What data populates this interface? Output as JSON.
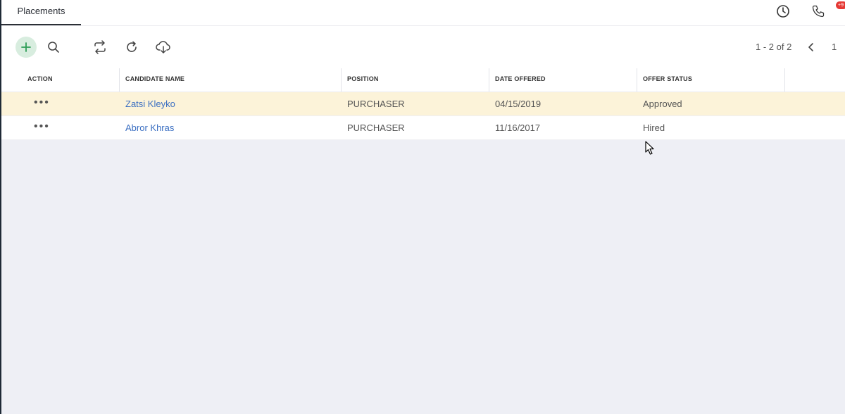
{
  "tab": {
    "label": "Placements"
  },
  "topbar": {
    "badge": "+9"
  },
  "pager": {
    "range": "1 - 2 of 2",
    "page": "1"
  },
  "table": {
    "headers": [
      "ACTION",
      "CANDIDATE NAME",
      "POSITION",
      "DATE OFFERED",
      "OFFER STATUS"
    ],
    "rows": [
      {
        "action": "•••",
        "candidate": "Zatsi Kleyko",
        "position": "PURCHASER",
        "date": "04/15/2019",
        "status": "Approved",
        "highlighted": true
      },
      {
        "action": "•••",
        "candidate": "Abror Khras",
        "position": "PURCHASER",
        "date": "11/16/2017",
        "status": "Hired",
        "highlighted": false
      }
    ]
  },
  "colors": {
    "accent_green": "#2e9d57",
    "link_blue": "#3b6fc2",
    "highlight_row": "#fcf3d9",
    "badge_red": "#e53935"
  }
}
